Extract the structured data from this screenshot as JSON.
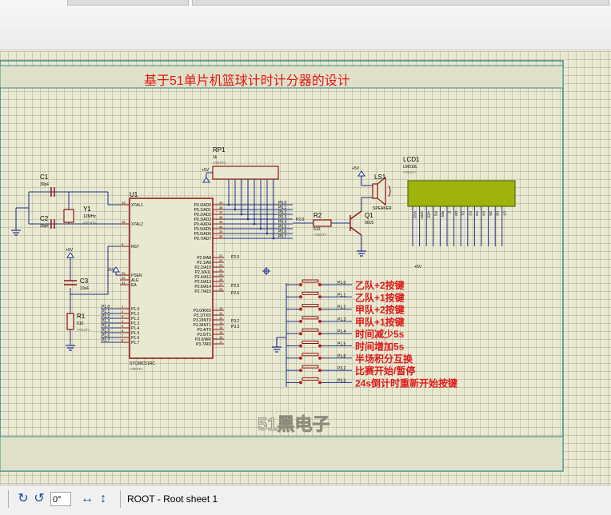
{
  "sheet": {
    "title": "基于51单片机篮球计时计分器的设计",
    "watermark": "51黑电子"
  },
  "components": {
    "rp1_ref": "RP1",
    "rp1_value": "1k",
    "c1_ref": "C1",
    "c1_value": "30pF",
    "c2_ref": "C2",
    "c2_value": "30pF",
    "y1_ref": "Y1",
    "y1_value": "12MHz",
    "u1_ref": "U1",
    "u1_part": "STC89C51RC",
    "c3_ref": "C3",
    "c3_value": "10uF",
    "r1_ref": "R1",
    "r1_value": "510",
    "r2_ref": "R2",
    "r2_value": "510",
    "q1_ref": "Q1",
    "q1_part": "9015",
    "ls1_ref": "LS1",
    "ls1_part": "SPEAKER",
    "lcd1_ref": "LCD1",
    "lcd1_part": "LM016L",
    "text_placeholder": "<TEXT>",
    "power_label": "+5V"
  },
  "u1_left_pins": [
    "XTAL1",
    "XTAL2",
    "RST",
    "PSEN",
    "ALE",
    "EA",
    "P1.0",
    "P1.1",
    "P1.2",
    "P1.3",
    "P1.4",
    "P1.5",
    "P1.6",
    "P1.7"
  ],
  "u1_left_pin_numbers": [
    "19",
    "18",
    "9",
    "29",
    "30",
    "31",
    "1",
    "2",
    "3",
    "4",
    "5",
    "6",
    "7",
    "8"
  ],
  "u1_right_pins": [
    "P0.0/AD0",
    "P0.1/AD1",
    "P0.2/AD2",
    "P0.3/AD3",
    "P0.4/AD4",
    "P0.5/AD5",
    "P0.6/AD6",
    "P0.7/AD7",
    "P2.0/A8",
    "P2.1/A9",
    "P2.2/A10",
    "P2.3/A11",
    "P2.4/A12",
    "P2.5/A13",
    "P2.6/A14",
    "P2.7/A15",
    "P3.0/RXD",
    "P3.1/TXD",
    "P3.2/INT0",
    "P3.3/INT1",
    "P3.4/T0",
    "P3.5/T1",
    "P3.6/WR",
    "P3.7/RD"
  ],
  "u1_right_pin_numbers": [
    "39",
    "38",
    "37",
    "36",
    "35",
    "34",
    "33",
    "32",
    "21",
    "22",
    "23",
    "24",
    "25",
    "26",
    "27",
    "28",
    "10",
    "11",
    "12",
    "13",
    "14",
    "15",
    "16",
    "17"
  ],
  "p0_net_labels": [
    "P0.0",
    "P0.1",
    "P0.2",
    "P0.3",
    "P0.4",
    "P0.5",
    "P0.6",
    "P0.7"
  ],
  "p1_net_labels": [
    "P1.0",
    "P1.1",
    "P1.2",
    "P1.3",
    "P1.4",
    "P1.5",
    "P1.6",
    "P1.7"
  ],
  "misc_net_labels": [
    "P2.0",
    "P2.5",
    "P2.6",
    "P3.2",
    "P3.3"
  ],
  "lcd_pins": [
    "VSS",
    "VDD",
    "VEE",
    "RS",
    "RW",
    "E",
    "D0",
    "D1",
    "D2",
    "D3",
    "D4",
    "D5",
    "D6",
    "D7"
  ],
  "buttons": [
    {
      "net": "P1.0",
      "label": "乙队+2按键"
    },
    {
      "net": "P1.1",
      "label": "乙队+1按键"
    },
    {
      "net": "P1.2",
      "label": "甲队+2按键"
    },
    {
      "net": "P1.3",
      "label": "甲队+1按键"
    },
    {
      "net": "P1.4",
      "label": "时间减少5s"
    },
    {
      "net": "P1.5",
      "label": "时间增加5s"
    },
    {
      "net": "P1.6",
      "label": "半场积分互换"
    },
    {
      "net": "P3.2",
      "label": "比赛开始/暂停"
    },
    {
      "net": "P3.3",
      "label": "24s倒计时重新开始按键"
    }
  ],
  "statusbar": {
    "rotation_value": "0°",
    "sheet_path": "ROOT - Root sheet 1"
  },
  "colors": {
    "canvas_bg": "#e9e9d1",
    "wire": "#1d2f8c",
    "component": "#8b1414",
    "label_red": "#e01818",
    "lcd_screen": "#9eb40c",
    "frame": "#3a8a8a"
  }
}
